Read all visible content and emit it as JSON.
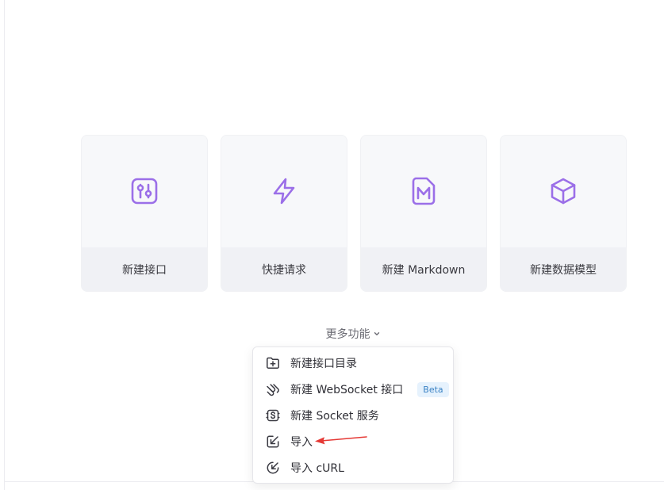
{
  "cards": [
    {
      "label": "新建接口",
      "icon": "api-interface-icon"
    },
    {
      "label": "快捷请求",
      "icon": "lightning-icon"
    },
    {
      "label": "新建 Markdown",
      "icon": "markdown-file-icon"
    },
    {
      "label": "新建数据模型",
      "icon": "cube-icon"
    }
  ],
  "more": {
    "label": "更多功能"
  },
  "menu": {
    "items": [
      {
        "label": "新建接口目录",
        "icon": "folder-plus-icon"
      },
      {
        "label": "新建 WebSocket 接口",
        "icon": "websocket-icon",
        "badge": "Beta"
      },
      {
        "label": "新建 Socket 服务",
        "icon": "socket-service-icon"
      },
      {
        "label": "导入",
        "icon": "import-icon"
      },
      {
        "label": "导入 cURL",
        "icon": "import-curl-icon"
      }
    ]
  },
  "colors": {
    "accent": "#9b6fe8",
    "annotation": "#e53935",
    "beta_text": "#3b82c4",
    "beta_bg": "#e6f2fd"
  }
}
